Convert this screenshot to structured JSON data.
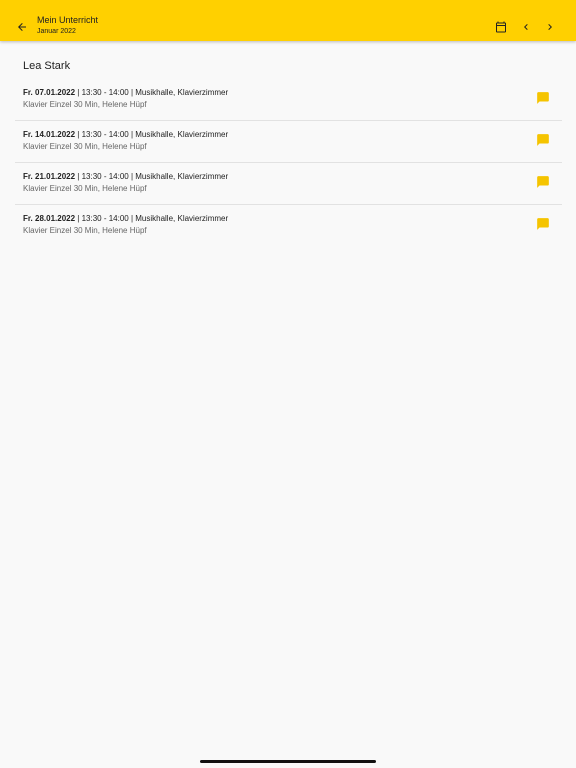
{
  "app_bar": {
    "title": "Mein Unterricht",
    "subtitle": "Januar 2022",
    "background_color": "#ffd000",
    "icons": {
      "back": "arrow-back-icon",
      "calendar": "calendar-icon",
      "previous": "chevron-left-icon",
      "next": "chevron-right-icon"
    }
  },
  "student": {
    "name": "Lea Stark"
  },
  "lessons": [
    {
      "date": "Fr. 07.01.2022",
      "details": " | 13:30 - 14:00 | Musikhalle, Klavierzimmer",
      "subtitle": "Klavier Einzel 30 Min, Helene Hüpf",
      "icon": "comment-icon"
    },
    {
      "date": "Fr. 14.01.2022",
      "details": " | 13:30 - 14:00 | Musikhalle, Klavierzimmer",
      "subtitle": "Klavier Einzel 30 Min, Helene Hüpf",
      "icon": "comment-icon"
    },
    {
      "date": "Fr. 21.01.2022",
      "details": " | 13:30 - 14:00 | Musikhalle, Klavierzimmer",
      "subtitle": "Klavier Einzel 30 Min, Helene Hüpf",
      "icon": "comment-icon"
    },
    {
      "date": "Fr. 28.01.2022",
      "details": " | 13:30 - 14:00 | Musikhalle, Klavierzimmer",
      "subtitle": "Klavier Einzel 30 Min, Helene Hüpf",
      "icon": "comment-icon"
    }
  ],
  "colors": {
    "accent": "#ffd000",
    "comment_icon": "#f5c400"
  }
}
